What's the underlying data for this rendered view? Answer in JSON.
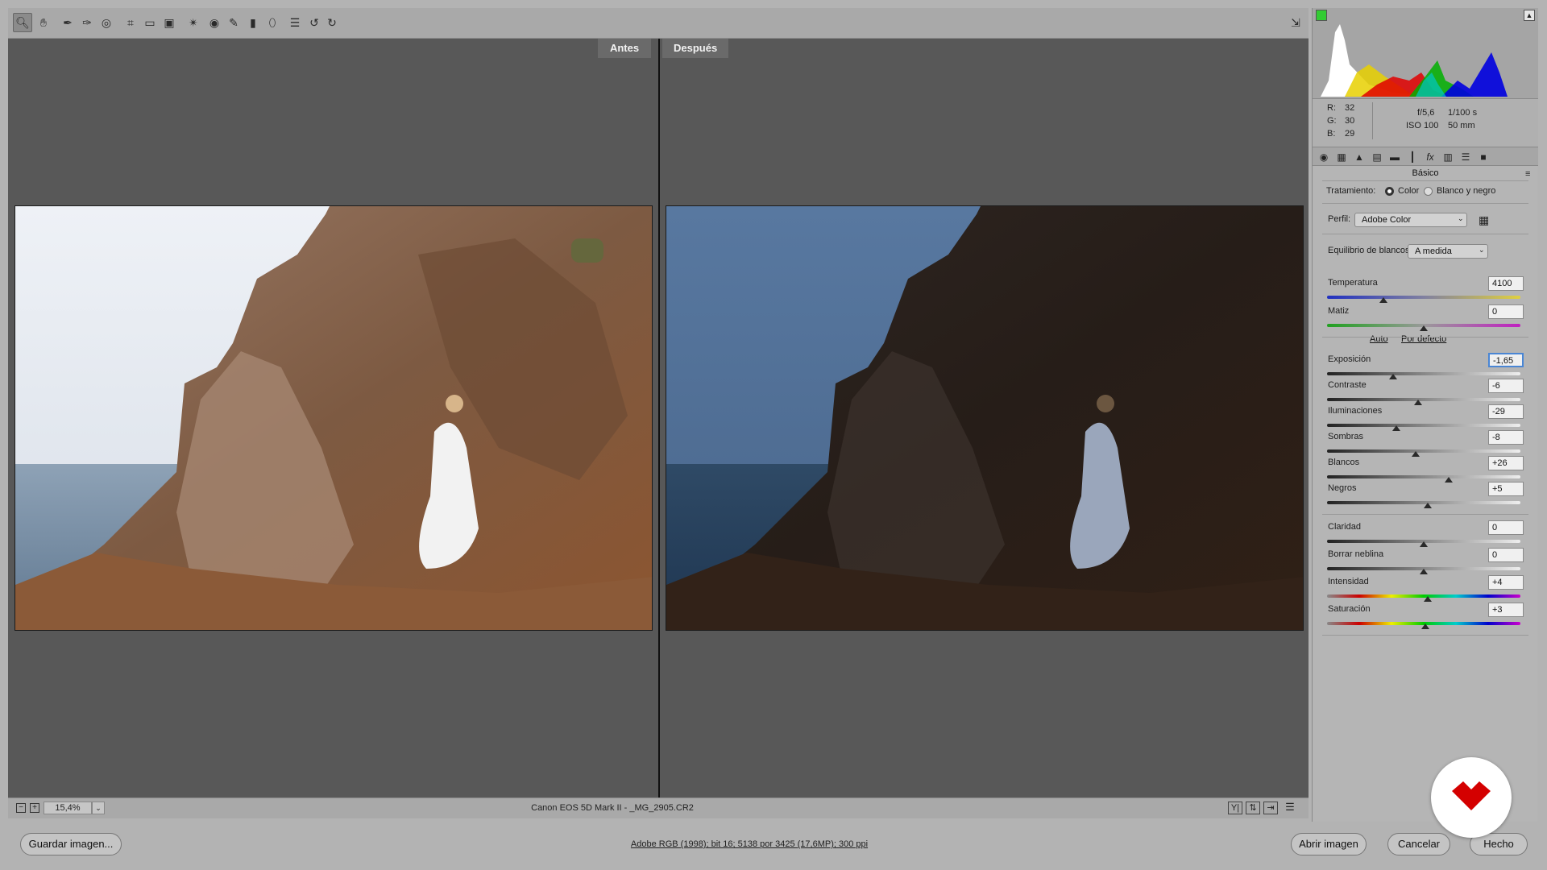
{
  "toolbar": {
    "tools": [
      "zoom-tool",
      "hand-tool",
      "white-balance-tool",
      "color-sampler-tool",
      "targeted-adjustment-tool",
      "crop-tool",
      "straighten-tool",
      "transform-tool",
      "spot-removal-tool",
      "red-eye-tool",
      "adjustment-brush-tool",
      "graduated-filter-tool",
      "radial-filter-tool",
      "preferences-tool",
      "rotate-ccw-tool",
      "rotate-cw-tool"
    ],
    "fullscreen_icon": "fullscreen-icon"
  },
  "view": {
    "before_label": "Antes",
    "after_label": "Después"
  },
  "status": {
    "zoom": "15,4%",
    "filename": "Canon EOS 5D Mark II -  _MG_2905.CR2"
  },
  "bottom": {
    "save_label": "Guardar imagen...",
    "workflow_link": "Adobe RGB (1998); bit 16; 5138 por 3425 (17,6MP); 300 ppi",
    "open_label": "Abrir imagen",
    "cancel_label": "Cancelar",
    "done_label": "Hecho"
  },
  "histogram": {
    "r_label": "R:",
    "r": "32",
    "g_label": "G:",
    "g": "30",
    "b_label": "B:",
    "b": "29",
    "aperture": "f/5,6",
    "shutter": "1/100 s",
    "iso": "ISO 100",
    "focal": "50 mm"
  },
  "panel": {
    "section_title": "Básico",
    "treatment_label": "Tratamiento:",
    "treatment_color": "Color",
    "treatment_bw": "Blanco y negro",
    "profile_label": "Perfil:",
    "profile_value": "Adobe Color",
    "wb_label": "Equilibrio de blancos:",
    "wb_value": "A medida",
    "auto_link": "Auto",
    "default_link": "Por defecto",
    "sliders": [
      {
        "label": "Temperatura",
        "value": "4100",
        "pos": 0.29
      },
      {
        "label": "Matiz",
        "value": "0",
        "pos": 0.5
      },
      {
        "label": "Exposición",
        "value": "-1,65",
        "pos": 0.34
      },
      {
        "label": "Contraste",
        "value": "-6",
        "pos": 0.47
      },
      {
        "label": "Iluminaciones",
        "value": "-29",
        "pos": 0.36
      },
      {
        "label": "Sombras",
        "value": "-8",
        "pos": 0.46
      },
      {
        "label": "Blancos",
        "value": "+26",
        "pos": 0.63
      },
      {
        "label": "Negros",
        "value": "+5",
        "pos": 0.52
      },
      {
        "label": "Claridad",
        "value": "0",
        "pos": 0.5
      },
      {
        "label": "Borrar neblina",
        "value": "0",
        "pos": 0.5
      },
      {
        "label": "Intensidad",
        "value": "+4",
        "pos": 0.52
      },
      {
        "label": "Saturación",
        "value": "+3",
        "pos": 0.51
      }
    ]
  },
  "colors": {
    "accent": "#4a86d4",
    "logo": "#d40000"
  }
}
